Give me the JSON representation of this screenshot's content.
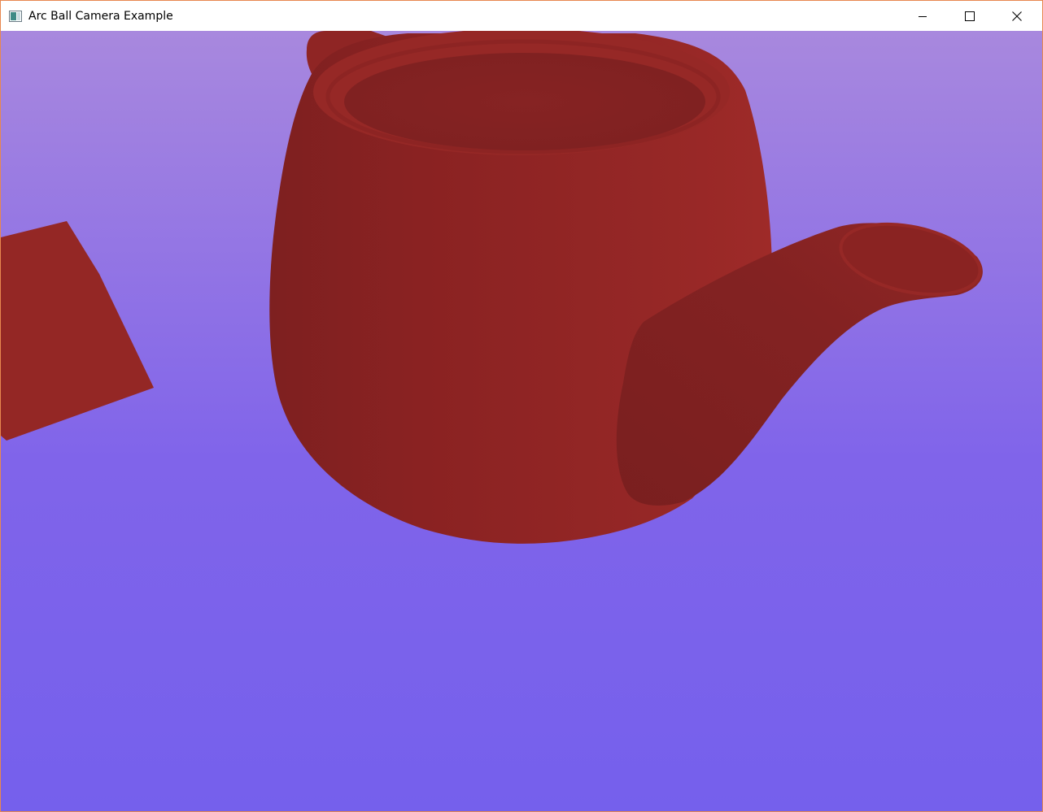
{
  "window": {
    "title": "Arc Ball Camera Example",
    "icon": "app-window-icon",
    "controls": {
      "minimize_icon": "minimize-icon",
      "maximize_icon": "maximize-icon",
      "close_icon": "close-icon"
    }
  },
  "scene": {
    "background_top_color": "#a888de",
    "background_bottom_color": "#7560ec",
    "object_color": "#912725",
    "objects": [
      "teapot",
      "cube"
    ]
  }
}
